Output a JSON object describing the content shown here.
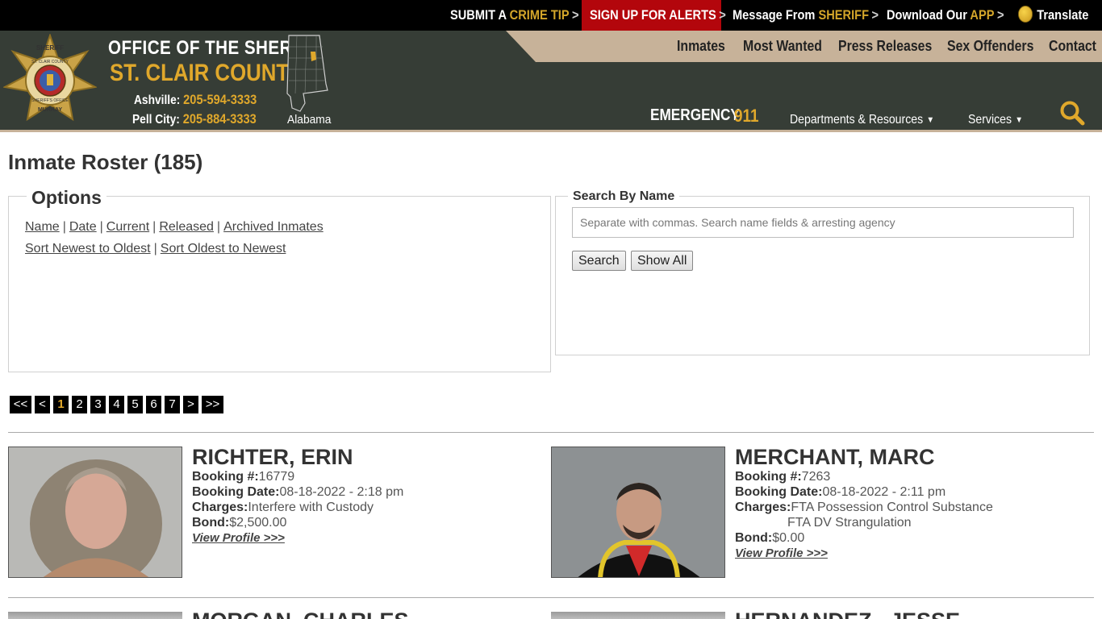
{
  "topbar": {
    "crime_tip": {
      "a": "SUBMIT A",
      "b": "CRIME TIP"
    },
    "alerts": "SIGN UP FOR ALERTS",
    "message": {
      "a": "Message From",
      "b": "SHERIFF"
    },
    "app": {
      "a": "Download Our",
      "b": "APP"
    },
    "translate": "Translate",
    "chevron": ">"
  },
  "header": {
    "office": "OFFICE OF THE SHERIFF",
    "county": "ST. CLAIR COUNTY",
    "phones": [
      {
        "city": "Ashville:",
        "number": "205-594-3333"
      },
      {
        "city": "Pell City:",
        "number": "205-884-3333"
      }
    ],
    "badge_text": {
      "top": "SHERIFF",
      "ring": "ST. CLAIR COUNTY",
      "ring2": "SHERIFF'S OFFICE",
      "bottom": "MURRAY"
    },
    "state": "Alabama",
    "emergency_label": "EMERGENCY",
    "emergency_number": "911",
    "nav": [
      "Inmates",
      "Most Wanted",
      "Press Releases",
      "Sex Offenders",
      "Contact"
    ],
    "dropdowns": [
      "Departments & Resources",
      "Services"
    ],
    "caret": "▼",
    "colors": {
      "header_bg": "#363d36",
      "nav_tan": "#c7b299",
      "gold": "#e0a82b",
      "alert_red": "#b3060c"
    }
  },
  "page": {
    "title": "Inmate Roster (185)",
    "options": {
      "legend": "Options",
      "sep": "|",
      "row1": [
        "Name",
        "Date",
        "Current",
        "Released",
        "Archived Inmates"
      ],
      "row2": [
        "Sort Newest to Oldest",
        "Sort Oldest to Newest"
      ]
    },
    "search": {
      "legend": "Search By Name",
      "placeholder": "Separate with commas. Search name fields & arresting agency",
      "search_btn": "Search",
      "show_all_btn": "Show All"
    },
    "pager": {
      "first": "<<",
      "prev": "<",
      "pages": [
        "1",
        "2",
        "3",
        "4",
        "5",
        "6",
        "7"
      ],
      "current": "1",
      "next": ">",
      "last": ">>"
    }
  },
  "labels": {
    "booking_no": "Booking #:",
    "booking_date": "Booking Date:",
    "charges": "Charges:",
    "bond": "Bond:",
    "view_profile": "View Profile >>>"
  },
  "inmates": [
    {
      "name": "RICHTER, ERIN",
      "booking_no": "16779",
      "booking_date": "08-18-2022 - 2:18 pm",
      "charges": [
        "Interfere with Custody"
      ],
      "bond": "$2,500.00"
    },
    {
      "name": "MERCHANT, MARC",
      "booking_no": "7263",
      "booking_date": "08-18-2022 - 2:11 pm",
      "charges": [
        "FTA Possession Control Substance",
        "FTA DV Strangulation"
      ],
      "bond": "$0.00"
    },
    {
      "name": "MORGAN, CHARLES"
    },
    {
      "name": "HERNANDEZ , JESSE"
    }
  ]
}
